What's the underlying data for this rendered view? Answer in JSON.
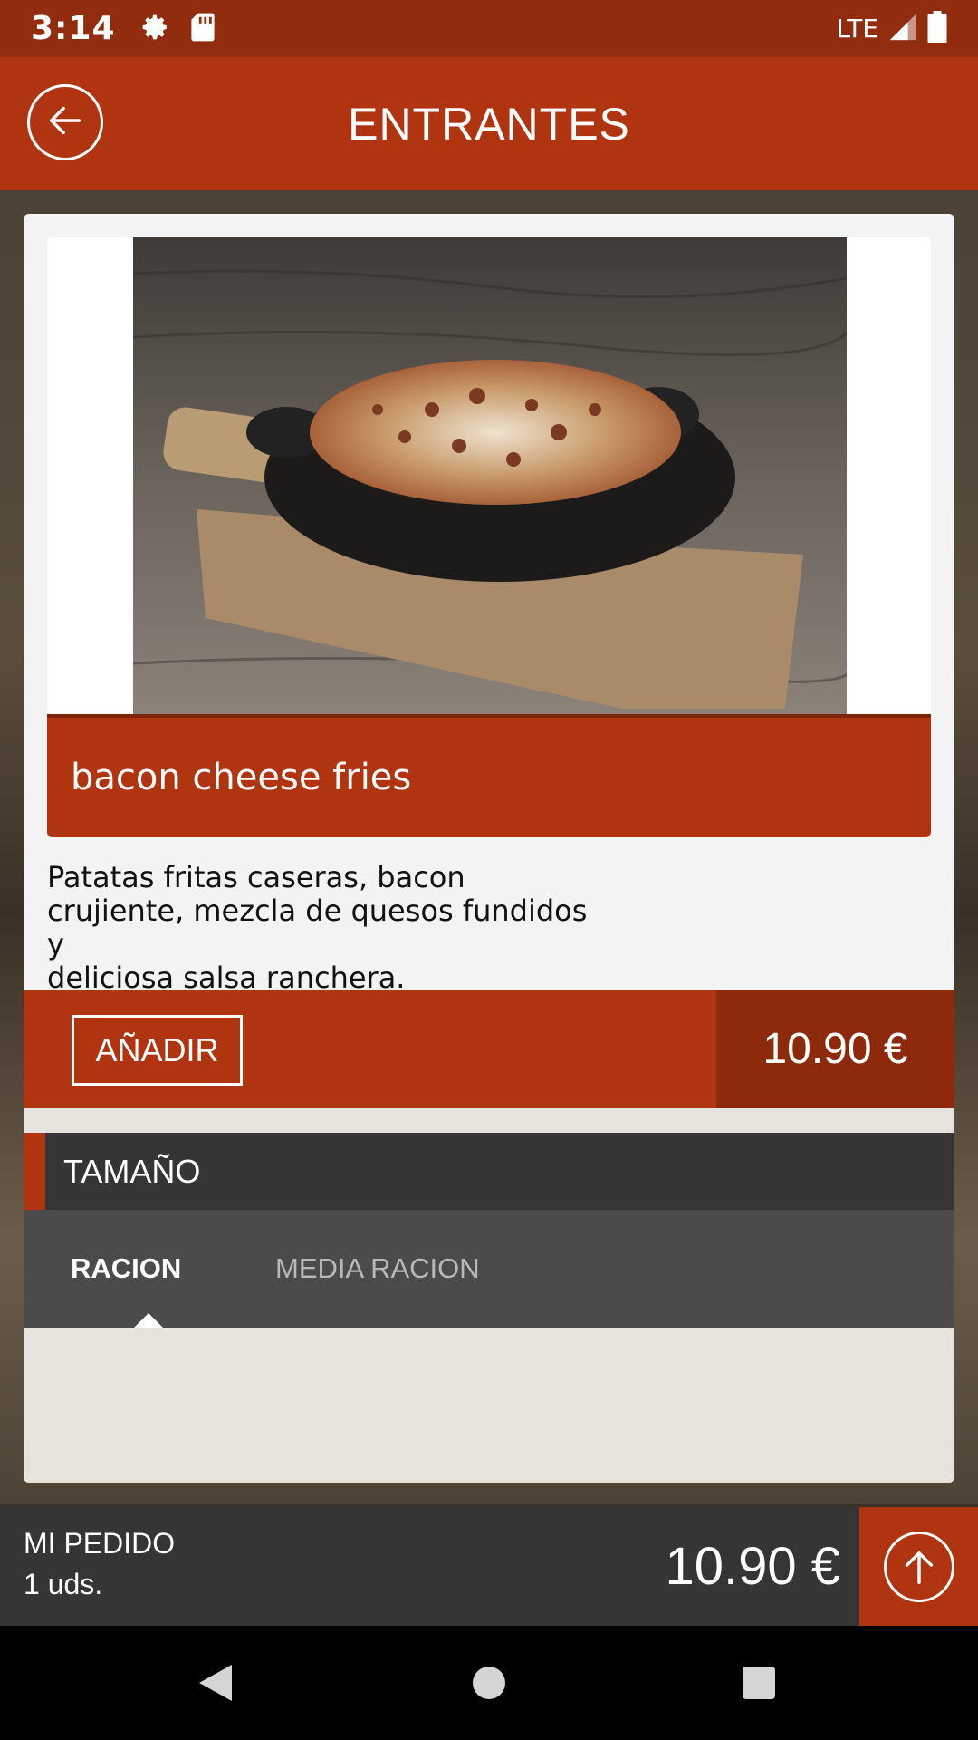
{
  "status_bar": {
    "time": "3:14",
    "network": "LTE",
    "icons": [
      "gear-icon",
      "sd-card-icon",
      "signal-icon",
      "battery-icon"
    ]
  },
  "app_bar": {
    "title": "ENTRANTES",
    "back_icon": "arrow-left-icon"
  },
  "product": {
    "name": "bacon cheese fries",
    "description": "Patatas fritas caseras, bacon crujiente, mezcla de quesos fundidos y deliciosa salsa ranchera.",
    "description_lines": [
      "Patatas fritas caseras, bacon",
      "crujiente, mezcla de quesos fundidos y",
      "deliciosa salsa ranchera."
    ],
    "add_label": "AÑADIR",
    "price": "10.90 €"
  },
  "options": {
    "section_title": "TAMAÑO",
    "tabs": [
      {
        "label": "RACION",
        "selected": true
      },
      {
        "label": "MEDIA RACION",
        "selected": false
      }
    ]
  },
  "order": {
    "label": "MI PEDIDO",
    "quantity": "1 uds.",
    "total": "10.90 €",
    "expand_icon": "arrow-up-icon"
  },
  "nav": {
    "icons": [
      "back-triangle-icon",
      "home-circle-icon",
      "recents-square-icon"
    ]
  },
  "colors": {
    "primary": "#b13411",
    "primary_dark": "#922c0e",
    "price_bg": "#8e2a0c",
    "dark_header": "#353535",
    "tab_bg": "#4b4b4b"
  }
}
